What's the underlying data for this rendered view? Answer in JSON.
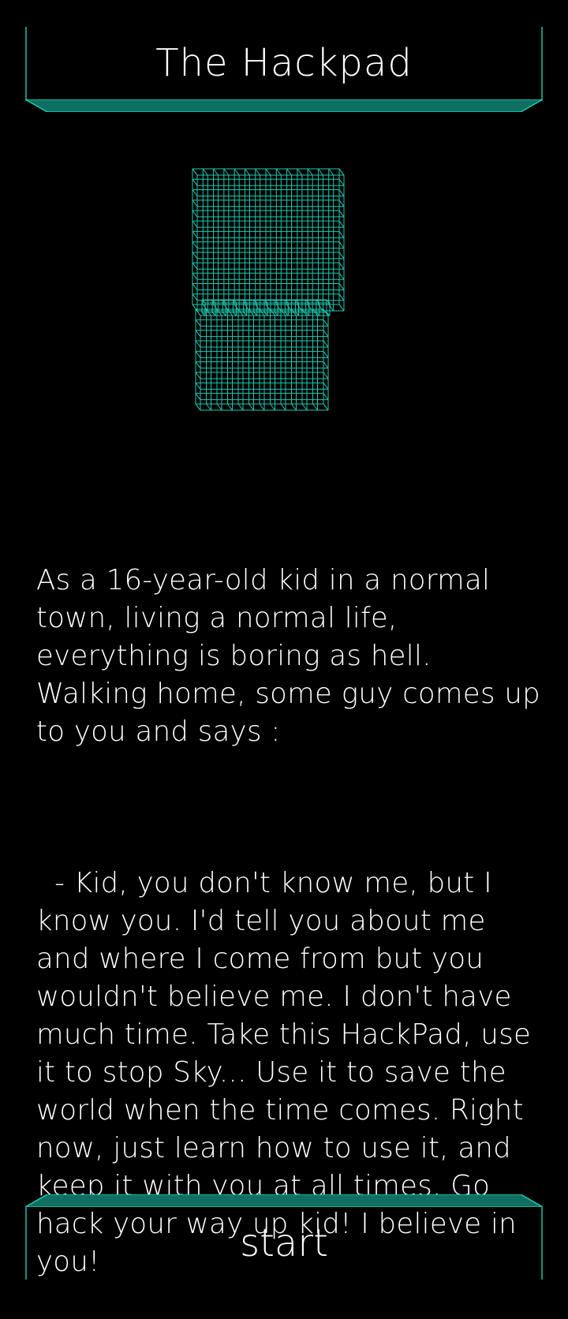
{
  "header": {
    "title": "The Hackpad"
  },
  "device": {
    "icon": "hackpad-wireframe-icon"
  },
  "story": {
    "paragraph1": "As a 16-year-old kid in a normal town, living a normal life, everything is boring as hell. Walking home, some guy comes up to you and says :",
    "paragraph2": "  - Kid, you don't know me, but I know you. I'd tell you about me and where I come from but you wouldn't believe me. I don't have much time. Take this HackPad, use it to stop Sky... Use it to save the world when the time comes. Right now, just learn how to use it, and keep it with you at all times. Go hack your way up kid! I believe in you!"
  },
  "start_button": {
    "label": "start"
  },
  "colors": {
    "background": "#000000",
    "accent": "#1fc9b0",
    "accent_dark": "#0f6f63",
    "text": "#ffffff"
  }
}
